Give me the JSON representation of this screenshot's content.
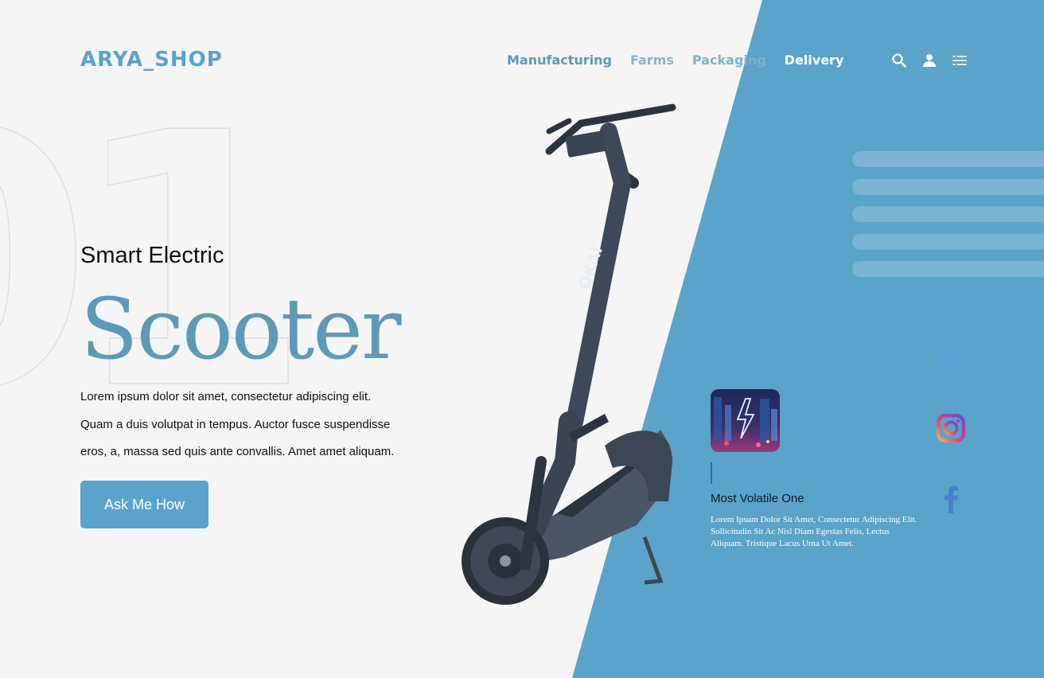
{
  "brand": {
    "logo": "ARYA_SHOP"
  },
  "nav": {
    "items": [
      "Manufacturing",
      "Farms",
      "Packaging",
      "Delivery"
    ]
  },
  "header_icons": [
    "search-icon",
    "user-icon",
    "menu-icon"
  ],
  "hero": {
    "background_number": "01",
    "subtitle": "Smart Electric",
    "title": "Scooter",
    "description_lines": [
      "Lorem ipsum dolor sit amet, consectetur adipiscing elit.",
      "Quam a duis volutpat in tempus. Auctor fusce suspendisse",
      "eros, a, massa sed quis ante convallis. Amet amet aliquam."
    ],
    "cta": "Ask Me How"
  },
  "product": {
    "brand_text": "OKAI"
  },
  "card": {
    "title": "Most Volatile One",
    "text": "Lorem Ipsum Dolor Sit Amet, Consectetur Adipiscing Elit. Sollicitudin Sit Ac Nisl Diam Egestas Felis, Lectus Aliquam. Tristique Lacus Urna Ut Amet."
  },
  "social": [
    "twitter-icon",
    "instagram-icon",
    "facebook-icon"
  ],
  "colors": {
    "accent": "#5aa3c9",
    "title": "#5e9ab8",
    "text": "#111111",
    "background": "#f5f5f5"
  }
}
